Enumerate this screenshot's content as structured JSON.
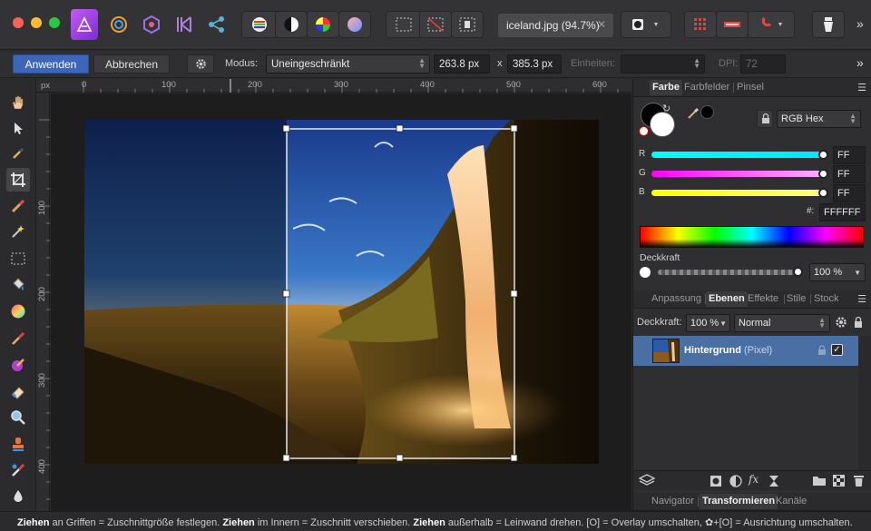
{
  "document": {
    "tab_label": "iceland.jpg (94.7%)",
    "close_glyph": "✕"
  },
  "context_toolbar": {
    "apply_label": "Anwenden",
    "cancel_label": "Abbrechen",
    "mode_label": "Modus:",
    "mode_value": "Uneingeschränkt",
    "width_value": "263.8 px",
    "x_separator": "x",
    "height_value": "385.3 px",
    "units_label": "Einheiten:",
    "units_value": "",
    "dpi_label": "DPI:",
    "dpi_value": "72"
  },
  "ruler": {
    "unit": "px",
    "top_ticks": [
      "0",
      "100",
      "200",
      "300",
      "400",
      "500",
      "600"
    ],
    "left_ticks": [
      "100",
      "200",
      "300",
      "400"
    ]
  },
  "color_panel": {
    "tabs": [
      "Farbe",
      "Farbfelder",
      "Pinsel"
    ],
    "mode_value": "RGB Hex",
    "channels": [
      {
        "label": "R",
        "value": "FF",
        "color": "#00e5ff"
      },
      {
        "label": "G",
        "value": "FF",
        "color": "#ff00ff"
      },
      {
        "label": "B",
        "value": "FF",
        "color": "#ffff00"
      }
    ],
    "hex_label": "#:",
    "hex_value": "FFFFFF",
    "opacity_label": "Deckkraft",
    "opacity_value": "100 %"
  },
  "layers_panel": {
    "tabs": [
      "Anpassung",
      "Ebenen",
      "Effekte",
      "Stile",
      "Stock"
    ],
    "opacity_label": "Deckkraft:",
    "opacity_value": "100 %",
    "blend_mode": "Normal",
    "layers": [
      {
        "name": "Hintergrund",
        "type": "(Pixel)",
        "visible": true
      }
    ]
  },
  "bottom_panel": {
    "tabs": [
      "Navigator",
      "Transformieren",
      "Kanäle"
    ]
  },
  "status": {
    "segments": [
      {
        "bold": "Ziehen",
        "text": " an Griffen = Zuschnittgröße festlegen. "
      },
      {
        "bold": "Ziehen",
        "text": " im Innern = Zuschnitt verschieben. "
      },
      {
        "bold": "Ziehen",
        "text": " außerhalb = Leinwand drehen. [O] = Overlay umschalten, ✿+[O] = Ausrichtung umschalten."
      }
    ]
  },
  "colors": {
    "accent": "#3d66b8",
    "selection": "#4a6fa5"
  }
}
